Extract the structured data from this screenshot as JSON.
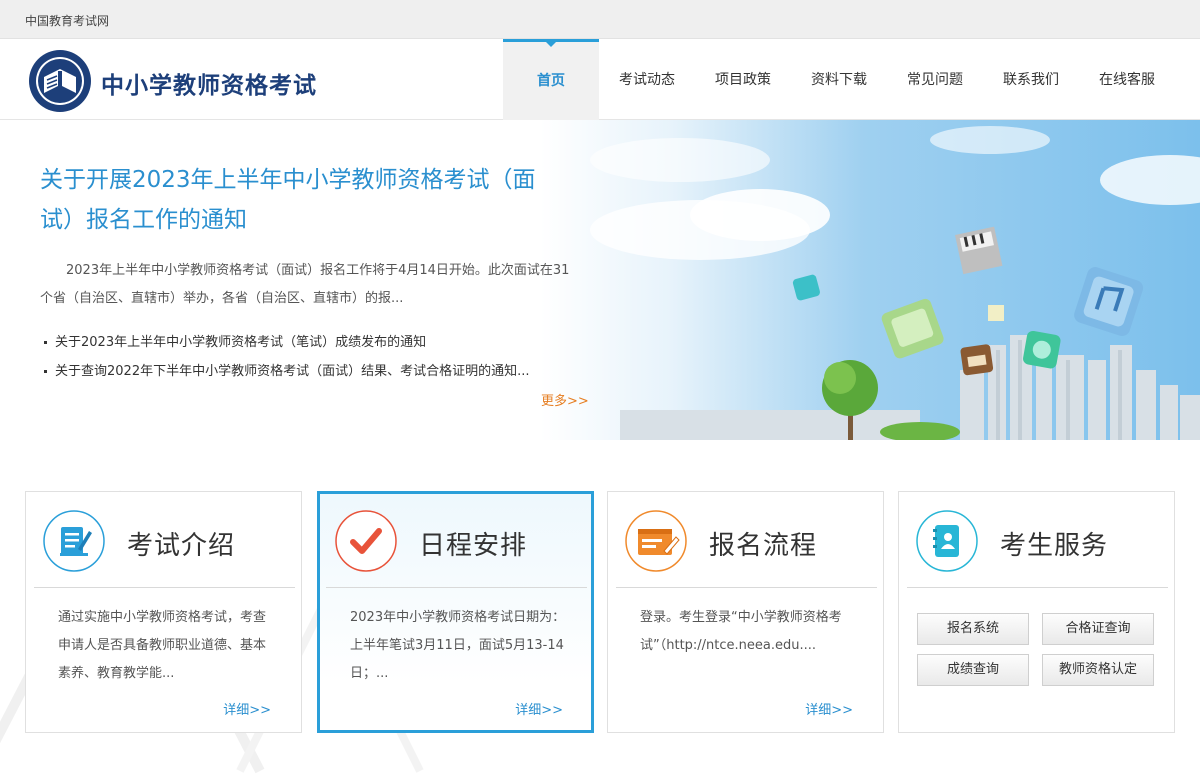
{
  "topbar": {
    "site_name": "中国教育考试网"
  },
  "header": {
    "brand": "中小学教师资格考试",
    "nav": [
      {
        "label": "首页",
        "active": true
      },
      {
        "label": "考试动态"
      },
      {
        "label": "项目政策"
      },
      {
        "label": "资料下载"
      },
      {
        "label": "常见问题"
      },
      {
        "label": "联系我们"
      },
      {
        "label": "在线客服"
      }
    ]
  },
  "banner": {
    "headline": "关于开展2023年上半年中小学教师资格考试（面试）报名工作的通知",
    "summary": "2023年上半年中小学教师资格考试（面试）报名工作将于4月14日开始。此次面试在31个省（自治区、直辖市）举办，各省（自治区、直辖市）的报...",
    "news": [
      "关于2023年上半年中小学教师资格考试（笔试）成绩发布的通知",
      "关于查询2022年下半年中小学教师资格考试（面试）结果、考试合格证明的通知..."
    ],
    "more": "更多>>"
  },
  "cards": [
    {
      "title": "考试介绍",
      "body": "通过实施中小学教师资格考试，考查申请人是否具备教师职业道德、基本素养、教育教学能...",
      "more": "详细>>"
    },
    {
      "title": "日程安排",
      "body": "2023年中小学教师资格考试日期为：上半年笔试3月11日，面试5月13-14日；...",
      "more": "详细>>"
    },
    {
      "title": "报名流程",
      "body": "登录。考生登录“中小学教师资格考试”（http://ntce.neea.edu....",
      "more": "详细>>"
    },
    {
      "title": "考生服务",
      "buttons": [
        "报名系统",
        "合格证查询",
        "成绩查询",
        "教师资格认定"
      ]
    }
  ],
  "colors": {
    "primary": "#2a9fd9",
    "brand": "#1d3f7a",
    "accent": "#e67e22",
    "check": "#e8533a",
    "form": "#f08a2c"
  },
  "icons": [
    "document-edit-icon",
    "checkmark-icon",
    "form-pen-icon",
    "contact-book-icon"
  ]
}
